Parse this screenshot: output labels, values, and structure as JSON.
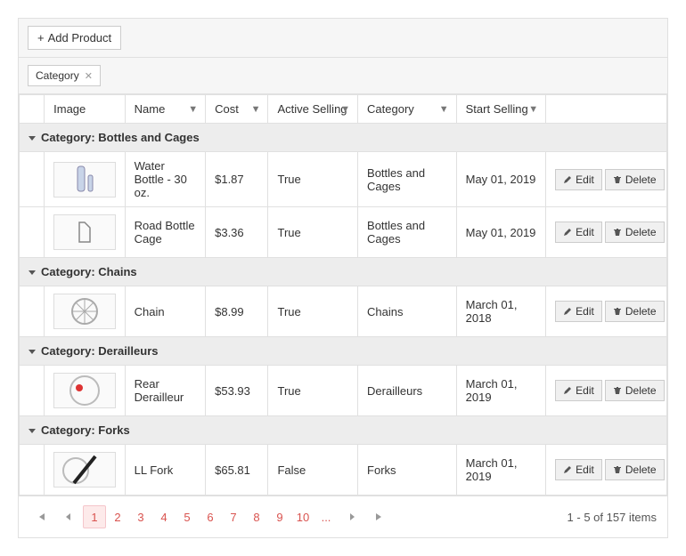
{
  "toolbar": {
    "add_label": "Add Product"
  },
  "grouping": {
    "chip_label": "Category"
  },
  "columns": {
    "image": "Image",
    "name": "Name",
    "cost": "Cost",
    "active": "Active Selling",
    "category": "Category",
    "start": "Start Selling"
  },
  "group_prefix": "Category: ",
  "groups": [
    {
      "name": "Bottles and Cages",
      "rows": [
        {
          "name": "Water Bottle - 30 oz.",
          "cost": "$1.87",
          "active": "True",
          "category": "Bottles and Cages",
          "start": "May 01, 2019",
          "img": "bottle"
        },
        {
          "name": "Road Bottle Cage",
          "cost": "$3.36",
          "active": "True",
          "category": "Bottles and Cages",
          "start": "May 01, 2019",
          "img": "cage"
        }
      ]
    },
    {
      "name": "Chains",
      "rows": [
        {
          "name": "Chain",
          "cost": "$8.99",
          "active": "True",
          "category": "Chains",
          "start": "March 01, 2018",
          "img": "chain"
        }
      ]
    },
    {
      "name": "Derailleurs",
      "rows": [
        {
          "name": "Rear Derailleur",
          "cost": "$53.93",
          "active": "True",
          "category": "Derailleurs",
          "start": "March 01, 2019",
          "img": "derailleur"
        }
      ]
    },
    {
      "name": "Forks",
      "rows": [
        {
          "name": "LL Fork",
          "cost": "$65.81",
          "active": "False",
          "category": "Forks",
          "start": "March 01, 2019",
          "img": "fork"
        }
      ]
    }
  ],
  "buttons": {
    "edit": "Edit",
    "delete": "Delete"
  },
  "pager": {
    "pages": [
      "1",
      "2",
      "3",
      "4",
      "5",
      "6",
      "7",
      "8",
      "9",
      "10",
      "..."
    ],
    "current": "1",
    "info": "1 - 5 of 157 items"
  }
}
